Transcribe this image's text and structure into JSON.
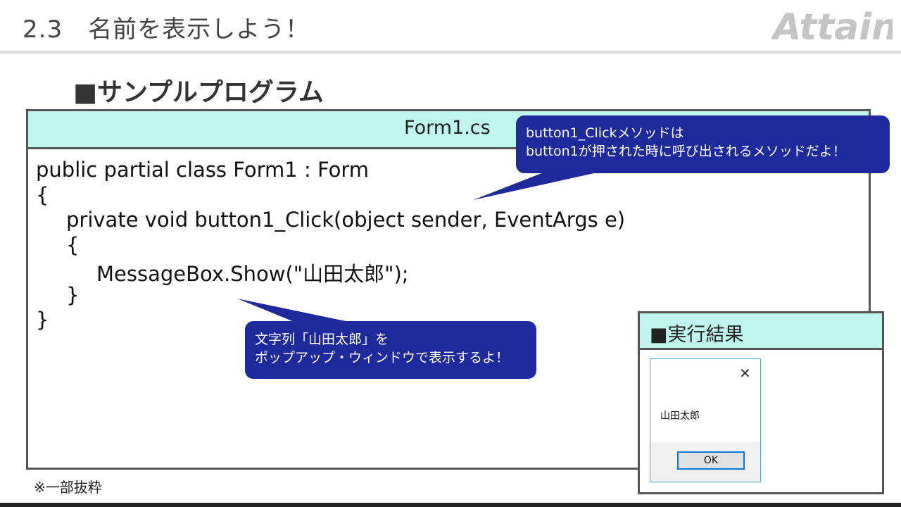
{
  "header": {
    "section_number": "2.3",
    "title": "名前を表示しよう！",
    "logo_text": "Attain"
  },
  "section_title": "■サンプルプログラム",
  "code": {
    "filename": "Form1.cs",
    "lines": [
      "public partial class Form1 : Form",
      "{",
      "private void button1_Click(object sender, EventArgs e)",
      "{",
      "MessageBox.Show(\"山田太郎\");",
      "}",
      "}"
    ]
  },
  "callouts": {
    "method": {
      "line1": "button1_Clickメソッドは",
      "line2": "button1が押された時に呼び出されるメソッドだよ！"
    },
    "string": {
      "line1": "文字列「山田太郎」を",
      "line2": "ポップアップ・ウィンドウで表示するよ！"
    }
  },
  "note": "※一部抜粋",
  "result": {
    "heading": "■実行結果",
    "message_text": "山田太郎",
    "close_glyph": "✕",
    "ok_label": "OK"
  },
  "colors": {
    "callout_bg": "#1e2a9c",
    "panel_header_bg": "#bff5ec",
    "border": "#555555",
    "ok_border": "#0078d7"
  }
}
